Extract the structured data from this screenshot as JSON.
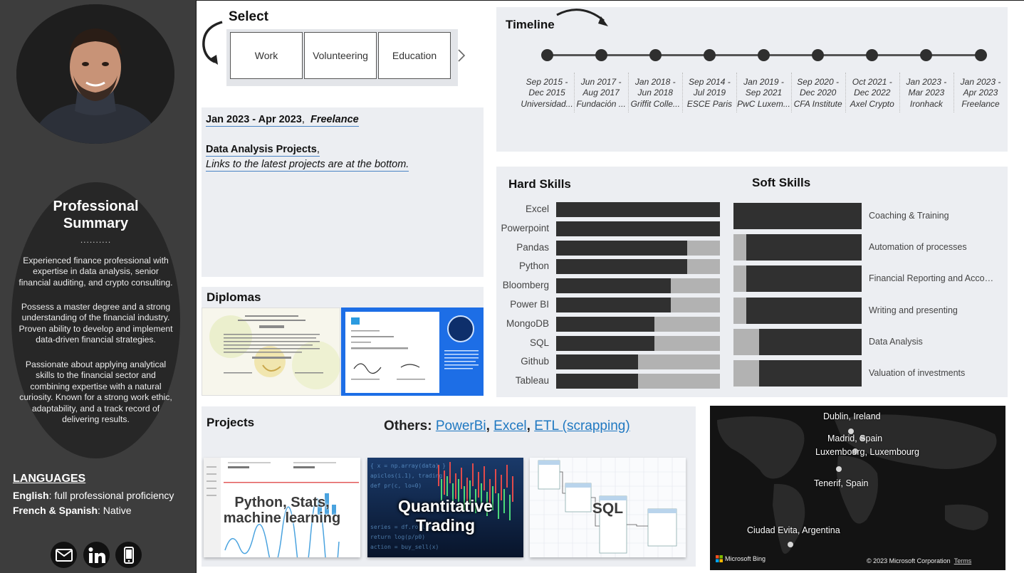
{
  "sidebar": {
    "summary_title_1": "Professional",
    "summary_title_2": "Summary",
    "summary_dots": "..........",
    "summary_p1": "Experienced finance professional with expertise in data analysis, senior financial auditing, and crypto consulting.",
    "summary_p2": "Possess a master degree and a strong understanding of the financial industry. Proven ability to develop and implement data-driven financial strategies.",
    "summary_p3": "Passionate about applying analytical skills to the financial sector and combining expertise with a natural curiosity. Known for a strong work ethic, adaptability, and a track record of delivering results.",
    "languages_title": "LANGUAGES",
    "lang1_name": "English",
    "lang1_level": ": full professional proficiency",
    "lang2_name": "French & Spanish",
    "lang2_level": ": Native",
    "icons": [
      "mail-icon",
      "linkedin-icon",
      "phone-icon"
    ]
  },
  "select": {
    "title": "Select",
    "tiles": [
      "Work",
      "Volunteering",
      "Education"
    ]
  },
  "experience": {
    "dates": "Jan 2023 - Apr 2023",
    "sep": ",",
    "company": "Freelance",
    "role": "Data Analysis Projects",
    "role_sep": ",",
    "note": "Links to the latest projects are at the bottom."
  },
  "timeline": {
    "title": "Timeline",
    "items": [
      {
        "l1": "Sep 2015 -",
        "l2": "Dec 2015",
        "l3": "Universidad..."
      },
      {
        "l1": "Jun 2017 -",
        "l2": "Aug 2017",
        "l3": "Fundación ..."
      },
      {
        "l1": "Jan 2018 -",
        "l2": "Jun 2018",
        "l3": "Griffit Colle..."
      },
      {
        "l1": "Sep 2014 -",
        "l2": "Jul 2019",
        "l3": "ESCE Paris"
      },
      {
        "l1": "Jan 2019 -",
        "l2": "Sep 2021",
        "l3": "PwC Luxem..."
      },
      {
        "l1": "Sep 2020 -",
        "l2": "Dec 2020",
        "l3": "CFA Institute"
      },
      {
        "l1": "Oct 2021 -",
        "l2": "Dec 2022",
        "l3": "Axel Crypto"
      },
      {
        "l1": "Jan 2023 -",
        "l2": "Mar 2023",
        "l3": "Ironhack"
      },
      {
        "l1": "Jan 2023 -",
        "l2": "Apr 2023",
        "l3": "Freelance"
      }
    ]
  },
  "hard_skills": {
    "title": "Hard Skills",
    "items": [
      {
        "name": "Excel",
        "level": 1.0
      },
      {
        "name": "Powerpoint",
        "level": 1.0
      },
      {
        "name": "Pandas",
        "level": 0.8
      },
      {
        "name": "Python",
        "level": 0.8
      },
      {
        "name": "Bloomberg",
        "level": 0.7
      },
      {
        "name": "Power BI",
        "level": 0.7
      },
      {
        "name": "MongoDB",
        "level": 0.6
      },
      {
        "name": "SQL",
        "level": 0.6
      },
      {
        "name": "Github",
        "level": 0.5
      },
      {
        "name": "Tableau",
        "level": 0.5
      }
    ]
  },
  "soft_skills": {
    "title": "Soft Skills",
    "items": [
      {
        "name": "Coaching & Training",
        "level": 1.0
      },
      {
        "name": "Automation of processes",
        "level": 0.9
      },
      {
        "name": "Financial Reporting and Accoun...",
        "level": 0.9
      },
      {
        "name": "Writing and presenting",
        "level": 0.9
      },
      {
        "name": "Data Analysis",
        "level": 0.8
      },
      {
        "name": "Valuation of investments",
        "level": 0.8
      }
    ]
  },
  "diplomas": {
    "title": "Diplomas"
  },
  "projects": {
    "title": "Projects",
    "others_label": "Others: ",
    "links": [
      "PowerBi",
      "Excel",
      "ETL (scrapping)"
    ],
    "link_seps": [
      ", ",
      ", "
    ],
    "cards": [
      {
        "label_1": "Python, Stats,",
        "label_2": "machine learning"
      },
      {
        "label_1": "Quantitative Trading"
      },
      {
        "label_1": "SQL"
      }
    ]
  },
  "map": {
    "cities": [
      "Dublin, Ireland",
      "Madrid, Spain",
      "Luxembourg, Luxembourg",
      "Tenerif, Spain",
      "Ciudad Evita, Argentina"
    ],
    "bing": "Microsoft Bing",
    "copyright": "© 2023 Microsoft Corporation",
    "terms": "Terms"
  }
}
